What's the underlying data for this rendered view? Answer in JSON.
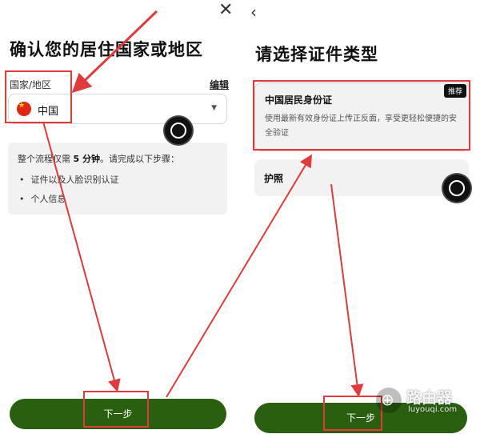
{
  "left_screen": {
    "close_icon": "close-icon",
    "title": "确认您的居住国家或地区",
    "country_label": "国家/地区",
    "edit_link": "编辑",
    "country_select": {
      "flag_icon": "china-flag-icon",
      "value": "中国"
    },
    "info": {
      "intro_prefix": "整个流程仅需 ",
      "intro_bold": "5 分钟",
      "intro_suffix": "。请完成以下步骤：",
      "steps": [
        "证件以及人脸识别认证",
        "个人信息"
      ]
    },
    "next_button": "下一步"
  },
  "right_screen": {
    "back_icon": "back-chevron-icon",
    "title": "请选择证件类型",
    "options": [
      {
        "title": "中国居民身份证",
        "description": "使用最新有效身份证上传正反面，享受更轻松便捷的安全验证",
        "badge": "推荐"
      },
      {
        "title": "护照"
      }
    ],
    "next_button": "下一步"
  },
  "watermark": {
    "name": "路由器",
    "domain": "luyouqi.com"
  },
  "colors": {
    "primary_button": "#295f0f",
    "annotation": "#e23a3a"
  }
}
